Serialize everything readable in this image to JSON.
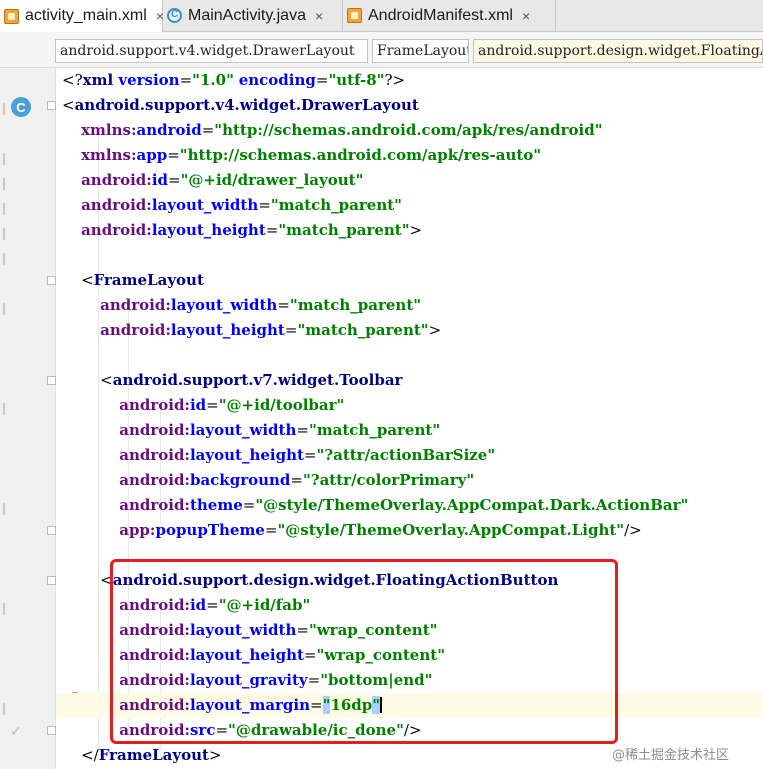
{
  "tabs": [
    {
      "label": "activity_main.xml",
      "icon": "xml-file-icon",
      "active": true
    },
    {
      "label": "MainActivity.java",
      "icon": "java-class-icon",
      "active": false
    },
    {
      "label": "AndroidManifest.xml",
      "icon": "xml-file-icon",
      "active": false
    }
  ],
  "tab_close_glyph": "×",
  "breadcrumb": [
    "android.support.v4.widget.DrawerLayout",
    "FrameLayout",
    "android.support.design.widget.FloatingActionButton"
  ],
  "gutter": {
    "class_icon_letter": "C"
  },
  "code_lines": [
    [
      [
        "pun",
        "<?"
      ],
      [
        "tag",
        "xml "
      ],
      [
        "attr",
        "version"
      ],
      [
        "pun",
        "="
      ],
      [
        "val",
        "\"1.0\""
      ],
      [
        "pun",
        " "
      ],
      [
        "attr",
        "encoding"
      ],
      [
        "pun",
        "="
      ],
      [
        "val",
        "\"utf-8\""
      ],
      [
        "pun",
        "?>"
      ]
    ],
    [
      [
        "pun",
        "<"
      ],
      [
        "tag",
        "android.support.v4.widget.DrawerLayout"
      ]
    ],
    [
      [
        "pun",
        "    "
      ],
      [
        "ns",
        "xmlns:"
      ],
      [
        "attr",
        "android"
      ],
      [
        "pun",
        "="
      ],
      [
        "val",
        "\"http://schemas.android.com/apk/res/android\""
      ]
    ],
    [
      [
        "pun",
        "    "
      ],
      [
        "ns",
        "xmlns:"
      ],
      [
        "attr",
        "app"
      ],
      [
        "pun",
        "="
      ],
      [
        "val",
        "\"http://schemas.android.com/apk/res-auto\""
      ]
    ],
    [
      [
        "pun",
        "    "
      ],
      [
        "ns",
        "android:"
      ],
      [
        "attr",
        "id"
      ],
      [
        "pun",
        "="
      ],
      [
        "val",
        "\"@+id/drawer_layout\""
      ]
    ],
    [
      [
        "pun",
        "    "
      ],
      [
        "ns",
        "android:"
      ],
      [
        "attr",
        "layout_width"
      ],
      [
        "pun",
        "="
      ],
      [
        "val",
        "\"match_parent\""
      ]
    ],
    [
      [
        "pun",
        "    "
      ],
      [
        "ns",
        "android:"
      ],
      [
        "attr",
        "layout_height"
      ],
      [
        "pun",
        "="
      ],
      [
        "val",
        "\"match_parent\""
      ],
      [
        "pun",
        ">"
      ]
    ],
    [],
    [
      [
        "pun",
        "    <"
      ],
      [
        "tag",
        "FrameLayout"
      ]
    ],
    [
      [
        "pun",
        "        "
      ],
      [
        "ns",
        "android:"
      ],
      [
        "attr",
        "layout_width"
      ],
      [
        "pun",
        "="
      ],
      [
        "val",
        "\"match_parent\""
      ]
    ],
    [
      [
        "pun",
        "        "
      ],
      [
        "ns",
        "android:"
      ],
      [
        "attr",
        "layout_height"
      ],
      [
        "pun",
        "="
      ],
      [
        "val",
        "\"match_parent\""
      ],
      [
        "pun",
        ">"
      ]
    ],
    [],
    [
      [
        "pun",
        "        <"
      ],
      [
        "tag",
        "android.support.v7.widget.Toolbar"
      ]
    ],
    [
      [
        "pun",
        "            "
      ],
      [
        "ns",
        "android:"
      ],
      [
        "attr",
        "id"
      ],
      [
        "pun",
        "="
      ],
      [
        "val",
        "\"@+id/toolbar\""
      ]
    ],
    [
      [
        "pun",
        "            "
      ],
      [
        "ns",
        "android:"
      ],
      [
        "attr",
        "layout_width"
      ],
      [
        "pun",
        "="
      ],
      [
        "val",
        "\"match_parent\""
      ]
    ],
    [
      [
        "pun",
        "            "
      ],
      [
        "ns",
        "android:"
      ],
      [
        "attr",
        "layout_height"
      ],
      [
        "pun",
        "="
      ],
      [
        "val",
        "\"?attr/actionBarSize\""
      ]
    ],
    [
      [
        "pun",
        "            "
      ],
      [
        "ns",
        "android:"
      ],
      [
        "attr",
        "background"
      ],
      [
        "pun",
        "="
      ],
      [
        "val",
        "\"?attr/colorPrimary\""
      ]
    ],
    [
      [
        "pun",
        "            "
      ],
      [
        "ns",
        "android:"
      ],
      [
        "attr",
        "theme"
      ],
      [
        "pun",
        "="
      ],
      [
        "val",
        "\"@style/ThemeOverlay.AppCompat.Dark.ActionBar\""
      ]
    ],
    [
      [
        "pun",
        "            "
      ],
      [
        "ns",
        "app:"
      ],
      [
        "attr",
        "popupTheme"
      ],
      [
        "pun",
        "="
      ],
      [
        "val",
        "\"@style/ThemeOverlay.AppCompat.Light\""
      ],
      [
        "pun",
        "/>"
      ]
    ],
    [],
    [
      [
        "pun",
        "        <"
      ],
      [
        "tag",
        "android.support.design.widget.FloatingActionButton"
      ]
    ],
    [
      [
        "pun",
        "            "
      ],
      [
        "ns",
        "android:"
      ],
      [
        "attr",
        "id"
      ],
      [
        "pun",
        "="
      ],
      [
        "val",
        "\"@+id/fab\""
      ]
    ],
    [
      [
        "pun",
        "            "
      ],
      [
        "ns",
        "android:"
      ],
      [
        "attr",
        "layout_width"
      ],
      [
        "pun",
        "="
      ],
      [
        "val",
        "\"wrap_content\""
      ]
    ],
    [
      [
        "pun",
        "            "
      ],
      [
        "ns",
        "android:"
      ],
      [
        "attr",
        "layout_height"
      ],
      [
        "pun",
        "="
      ],
      [
        "val",
        "\"wrap_content\""
      ]
    ],
    [
      [
        "pun",
        "            "
      ],
      [
        "ns",
        "android:"
      ],
      [
        "attr",
        "layout_gravity"
      ],
      [
        "pun",
        "="
      ],
      [
        "val",
        "\"bottom|end\""
      ]
    ],
    [
      [
        "pun",
        "            "
      ],
      [
        "ns",
        "android:"
      ],
      [
        "attr",
        "layout_margin"
      ],
      [
        "pun",
        "="
      ],
      [
        "sel",
        "\""
      ],
      [
        "val",
        "16dp"
      ],
      [
        "sel",
        "\""
      ],
      [
        "caret",
        ""
      ]
    ],
    [
      [
        "pun",
        "            "
      ],
      [
        "ns",
        "android:"
      ],
      [
        "attr",
        "src"
      ],
      [
        "pun",
        "="
      ],
      [
        "val",
        "\"@drawable/ic_done\""
      ],
      [
        "pun",
        "/>"
      ]
    ],
    [
      [
        "pun",
        "    </"
      ],
      [
        "tag",
        "FrameLayout"
      ],
      [
        "pun",
        ">"
      ]
    ]
  ],
  "watermark": "@稀土掘金技术社区",
  "colors": {
    "highlight_box": "#e21e1e",
    "tag": "#000080",
    "namespace": "#660e7a",
    "attribute": "#0000ff",
    "value": "#008000"
  }
}
